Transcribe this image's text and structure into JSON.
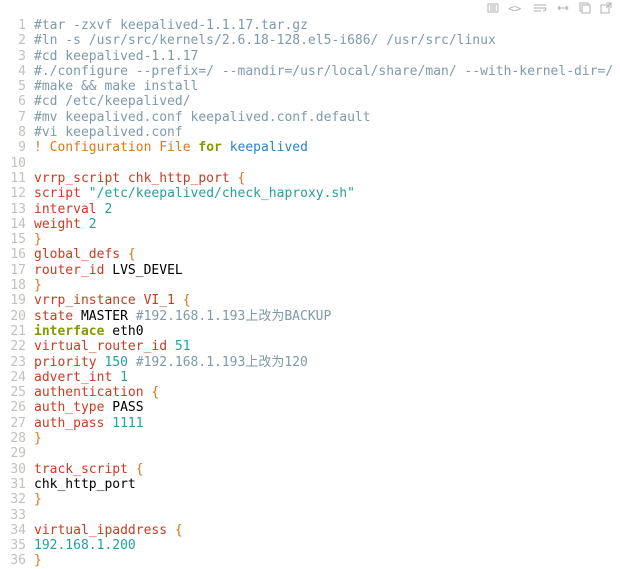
{
  "code": {
    "lines": [
      [
        {
          "cls": "c-comment",
          "t": "#tar -zxvf keepalived-1.1.17.tar.gz"
        }
      ],
      [
        {
          "cls": "c-comment",
          "t": "#ln -s /usr/src/kernels/2.6.18-128.el5-i686/ /usr/src/linux"
        }
      ],
      [
        {
          "cls": "c-comment",
          "t": "#cd keepalived-1.1.17"
        }
      ],
      [
        {
          "cls": "c-comment",
          "t": "#./configure --prefix=/ --mandir=/usr/local/share/man/ --with-kernel-dir=/"
        }
      ],
      [
        {
          "cls": "c-comment",
          "t": "#make && make install"
        }
      ],
      [
        {
          "cls": "c-comment",
          "t": "#cd /etc/keepalived/"
        }
      ],
      [
        {
          "cls": "c-comment",
          "t": "#mv keepalived.conf keepalived.conf.default"
        }
      ],
      [
        {
          "cls": "c-comment",
          "t": "#vi keepalived.conf"
        }
      ],
      [
        {
          "cls": "c-orange",
          "t": "! Configuration File "
        },
        {
          "cls": "c-keyword c-bold",
          "t": "for"
        },
        {
          "cls": "c-orange",
          "t": " "
        },
        {
          "cls": "c-blue",
          "t": "keepalived"
        }
      ],
      [
        {
          "cls": "",
          "t": ""
        }
      ],
      [
        {
          "cls": "c-red",
          "t": "vrrp_script chk_http_port "
        },
        {
          "cls": "c-orange",
          "t": "{"
        }
      ],
      [
        {
          "cls": "c-red",
          "t": "script "
        },
        {
          "cls": "c-string",
          "t": "\"/etc/keepalived/check_haproxy.sh\""
        }
      ],
      [
        {
          "cls": "c-red",
          "t": "interval "
        },
        {
          "cls": "c-string",
          "t": "2"
        }
      ],
      [
        {
          "cls": "c-red",
          "t": "weight "
        },
        {
          "cls": "c-string",
          "t": "2"
        }
      ],
      [
        {
          "cls": "c-orange",
          "t": "}"
        }
      ],
      [
        {
          "cls": "c-red",
          "t": "global_defs "
        },
        {
          "cls": "c-orange",
          "t": "{"
        }
      ],
      [
        {
          "cls": "c-red",
          "t": "router_id "
        },
        {
          "cls": "",
          "t": "LVS_DEVEL"
        }
      ],
      [
        {
          "cls": "c-orange",
          "t": "}"
        }
      ],
      [
        {
          "cls": "c-red",
          "t": "vrrp_instance VI_1 "
        },
        {
          "cls": "c-orange",
          "t": "{"
        }
      ],
      [
        {
          "cls": "c-red",
          "t": "state "
        },
        {
          "cls": "",
          "t": "MASTER "
        },
        {
          "cls": "c-comment",
          "t": "#192.168.1.193上改为BACKUP"
        }
      ],
      [
        {
          "cls": "c-keyword c-bold",
          "t": "interface"
        },
        {
          "cls": "c-red",
          "t": " "
        },
        {
          "cls": "",
          "t": "eth0"
        }
      ],
      [
        {
          "cls": "c-red",
          "t": "virtual_router_id "
        },
        {
          "cls": "c-string",
          "t": "51"
        }
      ],
      [
        {
          "cls": "c-red",
          "t": "priority "
        },
        {
          "cls": "c-string",
          "t": "150"
        },
        {
          "cls": "",
          "t": " "
        },
        {
          "cls": "c-comment",
          "t": "#192.168.1.193上改为120"
        }
      ],
      [
        {
          "cls": "c-red",
          "t": "advert_int "
        },
        {
          "cls": "c-string",
          "t": "1"
        }
      ],
      [
        {
          "cls": "c-red",
          "t": "authentication "
        },
        {
          "cls": "c-orange",
          "t": "{"
        }
      ],
      [
        {
          "cls": "c-red",
          "t": "auth_type "
        },
        {
          "cls": "",
          "t": "PASS"
        }
      ],
      [
        {
          "cls": "c-red",
          "t": "auth_pass "
        },
        {
          "cls": "c-string",
          "t": "1111"
        }
      ],
      [
        {
          "cls": "c-orange",
          "t": "}"
        }
      ],
      [
        {
          "cls": "",
          "t": ""
        }
      ],
      [
        {
          "cls": "c-red",
          "t": "track_script "
        },
        {
          "cls": "c-orange",
          "t": "{"
        }
      ],
      [
        {
          "cls": "",
          "t": "chk_http_port"
        }
      ],
      [
        {
          "cls": "c-orange",
          "t": "}"
        }
      ],
      [
        {
          "cls": "",
          "t": ""
        }
      ],
      [
        {
          "cls": "c-red",
          "t": "virtual_ipaddress "
        },
        {
          "cls": "c-orange",
          "t": "{"
        }
      ],
      [
        {
          "cls": "c-string",
          "t": "192.168.1.200"
        }
      ],
      [
        {
          "cls": "c-orange",
          "t": "}"
        }
      ]
    ]
  },
  "line_numbers": [
    "1",
    "2",
    "3",
    "4",
    "5",
    "6",
    "7",
    "8",
    "9",
    "10",
    "11",
    "12",
    "13",
    "14",
    "15",
    "16",
    "17",
    "18",
    "19",
    "20",
    "21",
    "22",
    "23",
    "24",
    "25",
    "26",
    "27",
    "28",
    "29",
    "30",
    "31",
    "32",
    "33",
    "34",
    "35",
    "36"
  ]
}
